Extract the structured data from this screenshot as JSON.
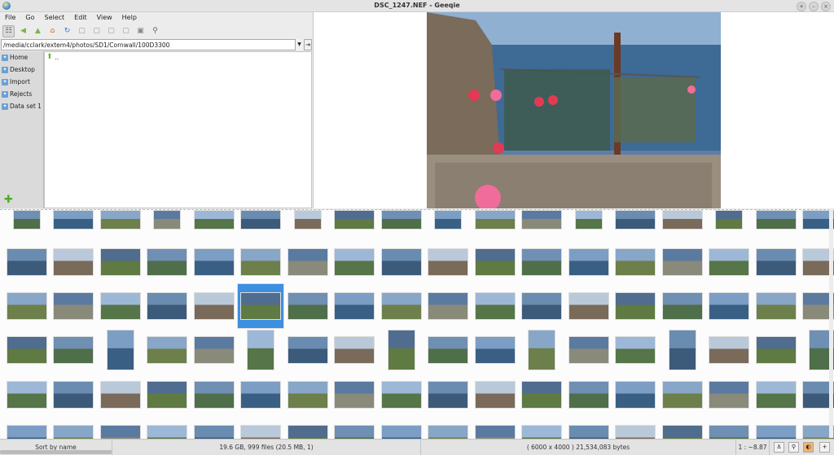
{
  "window": {
    "title": "DSC_1247.NEF - Geeqie"
  },
  "menu": [
    "File",
    "Go",
    "Select",
    "Edit",
    "View",
    "Help"
  ],
  "toolbar": [
    {
      "name": "thumbnails-toggle-icon",
      "glyph": "☷"
    },
    {
      "name": "back-icon",
      "glyph": "◀"
    },
    {
      "name": "up-folder-icon",
      "glyph": "▲"
    },
    {
      "name": "home-icon",
      "glyph": "⌂"
    },
    {
      "name": "refresh-icon",
      "glyph": "↻"
    },
    {
      "name": "zoom-in-icon",
      "glyph": "▢"
    },
    {
      "name": "zoom-out-icon",
      "glyph": "▢"
    },
    {
      "name": "zoom-100-icon",
      "glyph": "▢"
    },
    {
      "name": "zoom-fit-icon",
      "glyph": "▢"
    },
    {
      "name": "preferences-icon",
      "glyph": "▣"
    },
    {
      "name": "float-icon",
      "glyph": "⚲"
    }
  ],
  "path": {
    "value": "/media/cclark/extem4/photos/SD1/Cornwall/100D3300"
  },
  "bookmarks": [
    "Home",
    "Desktop",
    "Import",
    "Rejects",
    "Data set 1"
  ],
  "files": [
    ".."
  ],
  "status": {
    "sort": "Sort by name",
    "summary": "19.6 GB, 999 files (20.5 MB, 1)",
    "image_info": "( 6000 x 4000 ) 21,534,083 bytes",
    "zoom": "1 : ~8.87"
  },
  "colors": {
    "selection": "#3d8fe0",
    "accent_green": "#4caf1f"
  }
}
